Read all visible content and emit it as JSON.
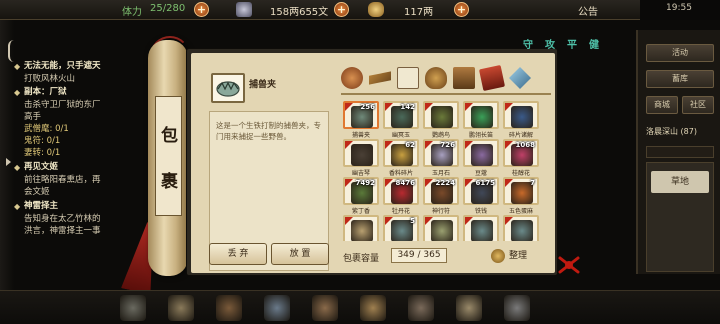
{
  "topbar": {
    "stamina_label": "体力",
    "stamina_value": "25/280",
    "coins_value": "158两655文",
    "silver_value": "117两",
    "announcement_label": "公告",
    "clock": "19:55"
  },
  "quests": [
    {
      "title": "无法无能，只手遮天",
      "lines": [
        "打败风林火山"
      ]
    },
    {
      "title": "副本：厂狱",
      "lines": [
        "击杀守卫厂狱的东厂",
        "高手"
      ],
      "stats": [
        "武僧麾: 0/1",
        "鬼符: 0/1",
        "妻转: 0/1"
      ]
    },
    {
      "title": "再见文姬",
      "lines": [
        "前往略阳春熏店，再",
        "会文姬"
      ]
    },
    {
      "title": "神雷择主",
      "lines": [
        "告知身在太乙竹林的",
        "洪言，神雷择主一事"
      ]
    }
  ],
  "scroll": {
    "char_top": "包",
    "char_bottom": "裹"
  },
  "selected_item": {
    "name": "捕兽夹",
    "description": "这是一个生铁打制的捕兽夹，专门用来捕捉一些野兽。"
  },
  "buttons": {
    "discard": "丢 弃",
    "place": "放 置",
    "sort": "整理"
  },
  "capacity": {
    "label": "包裹容量",
    "value": "349 / 365"
  },
  "category_tabs": [
    {
      "icon": "bag-icon"
    },
    {
      "icon": "crossbow-icon"
    },
    {
      "icon": "scroll-icon"
    },
    {
      "icon": "gourd-icon"
    },
    {
      "icon": "box-icon"
    },
    {
      "icon": "book-icon"
    },
    {
      "icon": "gem-icon"
    }
  ],
  "items": [
    {
      "name": "捕兽夹",
      "count": "256",
      "color": "#6f8a7a"
    },
    {
      "name": "幽冥玉",
      "count": "142",
      "color": "#4a6a5a"
    },
    {
      "name": "鹦鹉鸟",
      "count": "",
      "color": "#6a7a3a"
    },
    {
      "name": "鹏翎长笛",
      "count": "",
      "color": "#3aa058"
    },
    {
      "name": "碎片诸解",
      "count": "",
      "color": "#3a5a8a"
    },
    {
      "name": "幽吉琴",
      "count": "",
      "color": "#4a4036"
    },
    {
      "name": "香料碎片",
      "count": "62",
      "color": "#c8a040"
    },
    {
      "name": "玉月石",
      "count": "726",
      "color": "#a8a0c0"
    },
    {
      "name": "豆蔻",
      "count": "",
      "color": "#8a6aa0"
    },
    {
      "name": "桂醇花",
      "count": "1068",
      "color": "#c04068"
    },
    {
      "name": "紫丁香",
      "count": "7492",
      "color": "#5a7a3a"
    },
    {
      "name": "牡丹花",
      "count": "8476",
      "color": "#b82a30"
    },
    {
      "name": "神行符",
      "count": "2224",
      "color": "#7a4a2a"
    },
    {
      "name": "铁钱",
      "count": "6175",
      "color": "#404858"
    },
    {
      "name": "五色蛋麻",
      "count": "7",
      "color": "#c86a2a"
    },
    {
      "name": "",
      "count": "",
      "color": "#b8a070"
    },
    {
      "name": "",
      "count": "5",
      "color": "#6a8a8a"
    },
    {
      "name": "",
      "count": "",
      "color": "#9aa070"
    },
    {
      "name": "",
      "count": "",
      "color": "#6a8a8a"
    },
    {
      "name": "",
      "count": "",
      "color": "#6a8a8a"
    }
  ],
  "right_tabs": [
    "守",
    "攻",
    "平",
    "健"
  ],
  "right_buttons": [
    "活动",
    "蓄库",
    "商城",
    "社区"
  ],
  "map": {
    "location": "洛晨深山 (87)",
    "option": "草地"
  },
  "bottom_icons": [
    "pet-icon",
    "sword-icon",
    "horse-icon",
    "skill-icon",
    "team-icon",
    "bag-icon",
    "craft-icon",
    "quest-icon",
    "settings-icon"
  ]
}
